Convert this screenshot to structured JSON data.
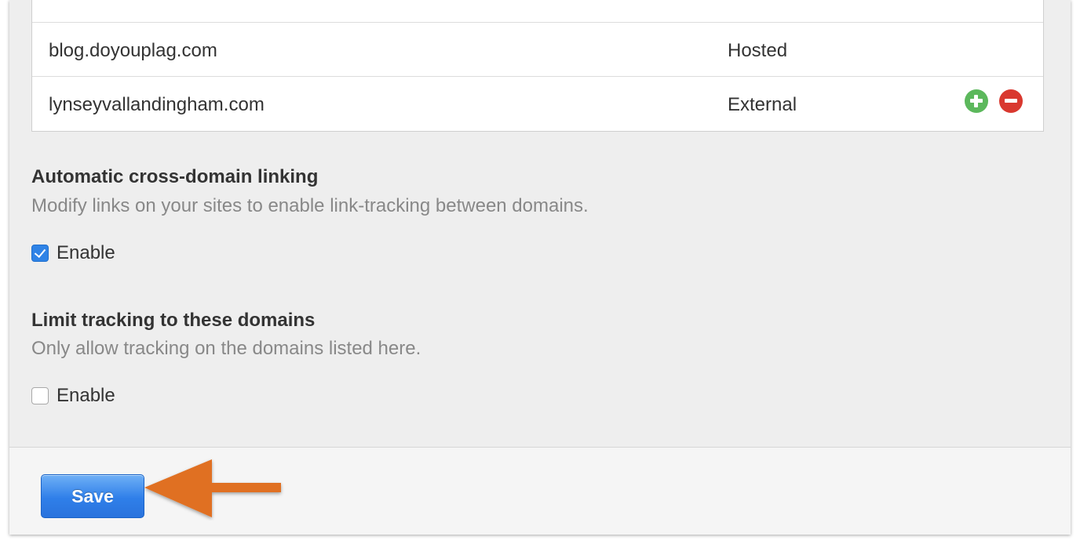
{
  "domains": [
    {
      "name": "blog.doyouplag.com",
      "type": "Hosted"
    },
    {
      "name": "lynseyvallandingham.com",
      "type": "External"
    }
  ],
  "cross_domain": {
    "title": "Automatic cross-domain linking",
    "description": "Modify links on your sites to enable link-tracking between domains.",
    "enable_label": "Enable",
    "enabled": true
  },
  "limit_tracking": {
    "title": "Limit tracking to these domains",
    "description": "Only allow tracking on the domains listed here.",
    "enable_label": "Enable",
    "enabled": false
  },
  "footer": {
    "save_label": "Save"
  },
  "colors": {
    "add": "#5cb85c",
    "remove": "#d9382f",
    "primary": "#2f7fe9",
    "annotation_arrow": "#e07020"
  }
}
